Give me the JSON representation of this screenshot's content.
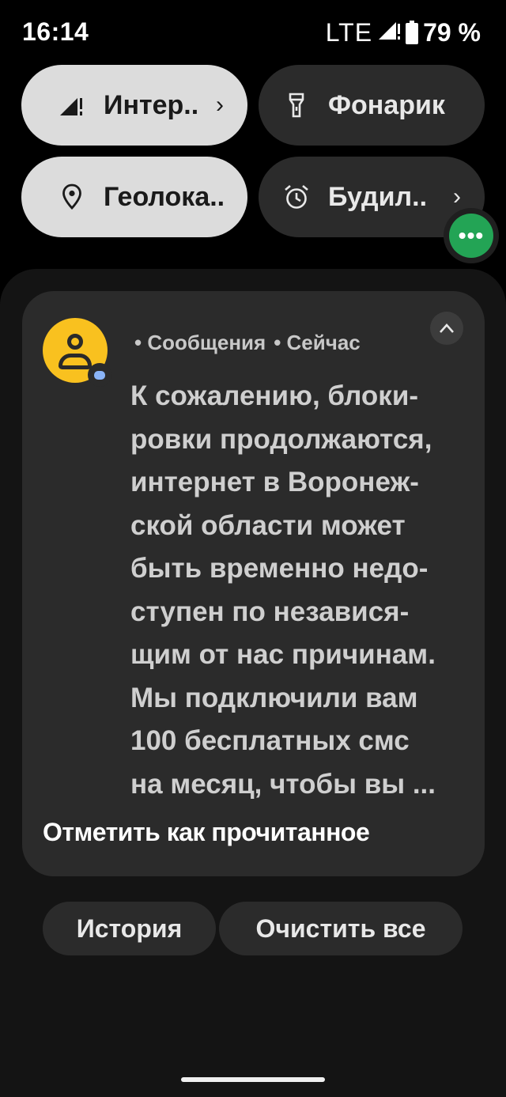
{
  "status_bar": {
    "time": "16:14",
    "network": "LTE",
    "battery": "79 %"
  },
  "quick_settings": {
    "tiles": [
      {
        "label": "Интер..",
        "icon": "signal-icon",
        "active": true,
        "has_chevron": true
      },
      {
        "label": "Фонарик",
        "icon": "flashlight-icon",
        "active": false,
        "has_chevron": false
      },
      {
        "label": "Геолока..",
        "icon": "location-icon",
        "active": true,
        "has_chevron": false
      },
      {
        "label": "Будил..",
        "icon": "alarm-icon",
        "active": false,
        "has_chevron": true
      }
    ],
    "chevron": "›",
    "bubble_icon": "more-dots-icon",
    "bubble_text": "•••"
  },
  "notification": {
    "app_name": "• Сообщения",
    "time": "• Сейчас",
    "body_lines": [
      "К сожалению, блоки-",
      "ровки продолжаются,",
      "интернет в Воронеж-",
      "ской области может",
      "быть временно недо-",
      "ступен по независя-",
      "щим от нас причинам.",
      "Мы подключили вам",
      "100 бесплатных смс",
      "на месяц, чтобы вы ..."
    ],
    "action": "Отметить как прочитанное"
  },
  "footer": {
    "history": "История",
    "clear_all": "Очистить все"
  },
  "colors": {
    "active_tile": "#dcdcdc",
    "inactive_tile": "#2b2b2b",
    "avatar": "#f9c11f",
    "bubble": "#23a455"
  }
}
